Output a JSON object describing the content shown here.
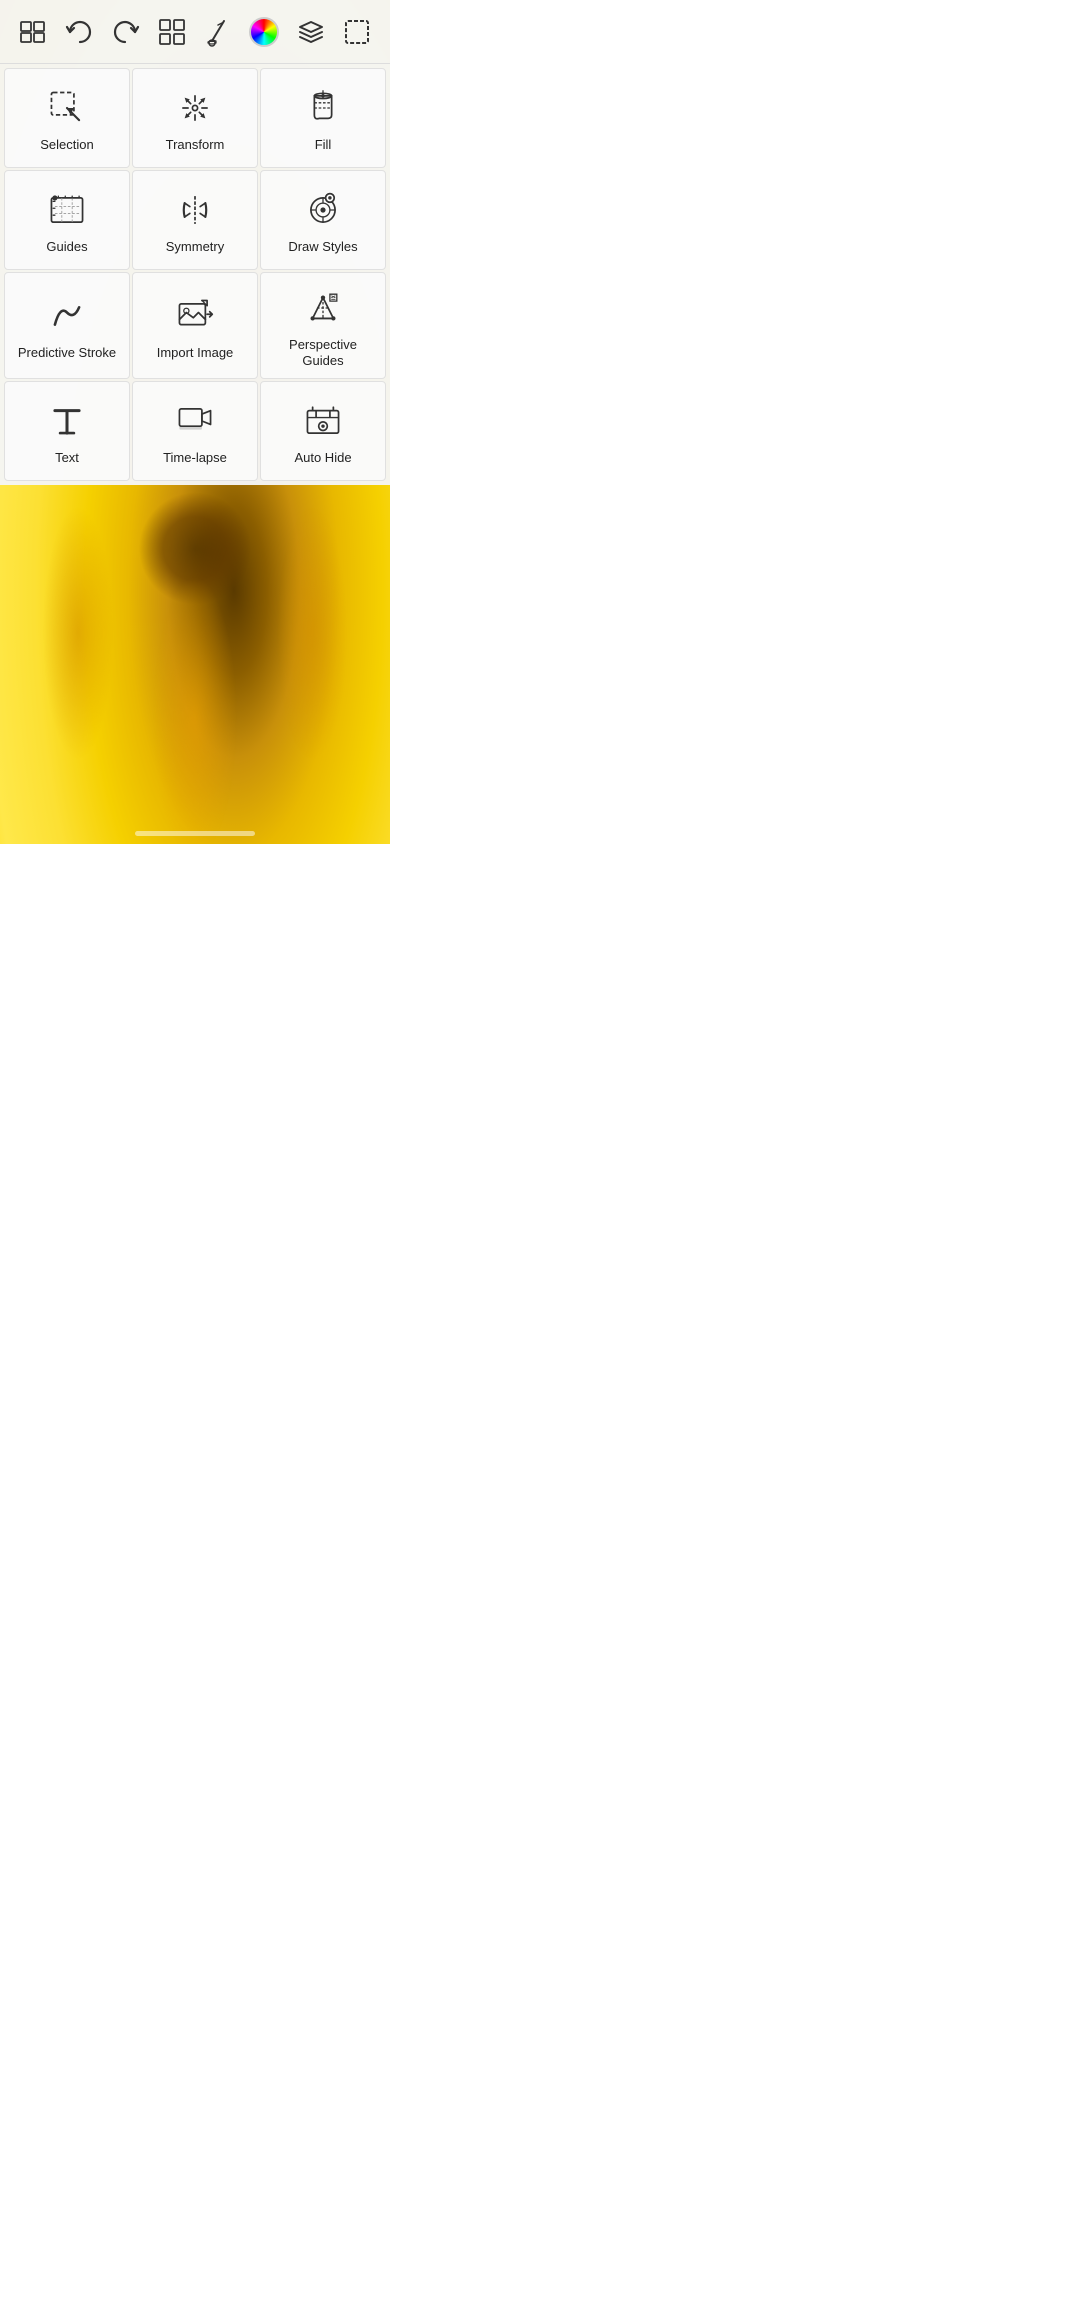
{
  "toolbar": {
    "items_label": "Menu",
    "undo_label": "Undo",
    "redo_label": "Redo",
    "grid_label": "Grid View",
    "brush_label": "Brush",
    "color_label": "Color",
    "layers_label": "Layers",
    "selection_label": "Selection Mode"
  },
  "menu": {
    "items": [
      {
        "id": "selection",
        "label": "Selection",
        "icon": "selection"
      },
      {
        "id": "transform",
        "label": "Transform",
        "icon": "transform"
      },
      {
        "id": "fill",
        "label": "Fill",
        "icon": "fill"
      },
      {
        "id": "guides",
        "label": "Guides",
        "icon": "guides"
      },
      {
        "id": "symmetry",
        "label": "Symmetry",
        "icon": "symmetry"
      },
      {
        "id": "draw-styles",
        "label": "Draw Styles",
        "icon": "draw-styles"
      },
      {
        "id": "predictive-stroke",
        "label": "Predictive Stroke",
        "icon": "predictive-stroke"
      },
      {
        "id": "import-image",
        "label": "Import Image",
        "icon": "import-image"
      },
      {
        "id": "perspective-guides",
        "label": "Perspective Guides",
        "icon": "perspective-guides"
      },
      {
        "id": "text",
        "label": "Text",
        "icon": "text"
      },
      {
        "id": "time-lapse",
        "label": "Time-lapse",
        "icon": "time-lapse"
      },
      {
        "id": "auto-hide",
        "label": "Auto Hide",
        "icon": "auto-hide"
      }
    ]
  }
}
